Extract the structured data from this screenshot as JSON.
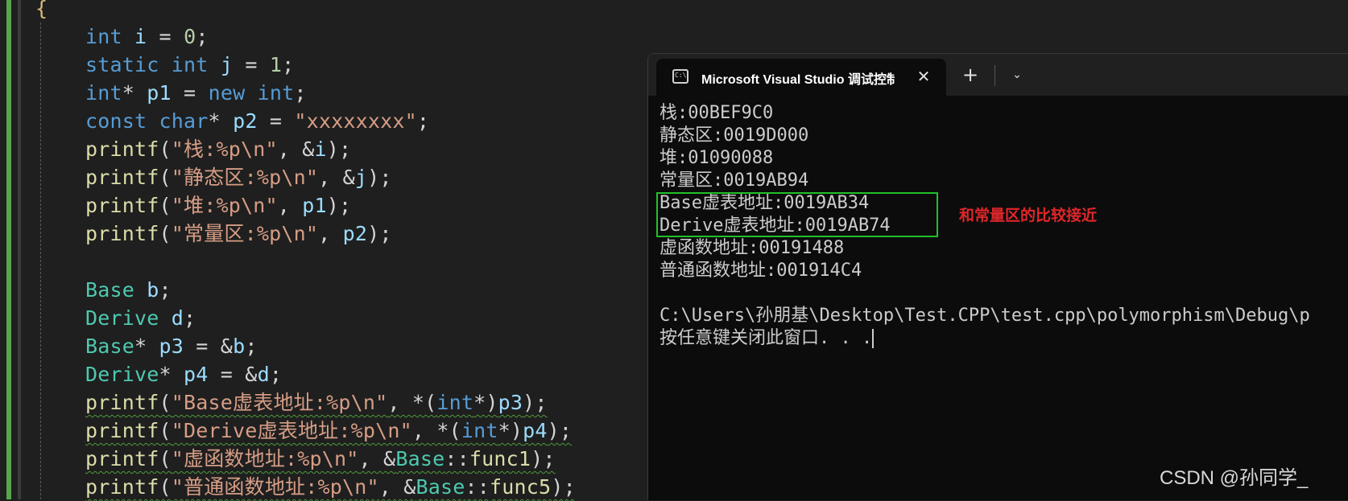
{
  "editor": {
    "open_brace": "{",
    "lines": [
      [
        [
          "kw",
          "int"
        ],
        [
          "op",
          " "
        ],
        [
          "var",
          "i"
        ],
        [
          "op",
          " = "
        ],
        [
          "num",
          "0"
        ],
        [
          "op",
          ";"
        ]
      ],
      [
        [
          "kw",
          "static"
        ],
        [
          "op",
          " "
        ],
        [
          "kw",
          "int"
        ],
        [
          "op",
          " "
        ],
        [
          "var",
          "j"
        ],
        [
          "op",
          " = "
        ],
        [
          "num",
          "1"
        ],
        [
          "op",
          ";"
        ]
      ],
      [
        [
          "kw",
          "int"
        ],
        [
          "op",
          "* "
        ],
        [
          "var",
          "p1"
        ],
        [
          "op",
          " = "
        ],
        [
          "kw",
          "new"
        ],
        [
          "op",
          " "
        ],
        [
          "kw",
          "int"
        ],
        [
          "op",
          ";"
        ]
      ],
      [
        [
          "kw",
          "const"
        ],
        [
          "op",
          " "
        ],
        [
          "kw",
          "char"
        ],
        [
          "op",
          "* "
        ],
        [
          "var",
          "p2"
        ],
        [
          "op",
          " = "
        ],
        [
          "str",
          "\"xxxxxxxx\""
        ],
        [
          "op",
          ";"
        ]
      ],
      [
        [
          "fn",
          "printf"
        ],
        [
          "op",
          "("
        ],
        [
          "str",
          "\"栈:%p\\n\""
        ],
        [
          "op",
          ", &"
        ],
        [
          "var",
          "i"
        ],
        [
          "op",
          ");"
        ]
      ],
      [
        [
          "fn",
          "printf"
        ],
        [
          "op",
          "("
        ],
        [
          "str",
          "\"静态区:%p\\n\""
        ],
        [
          "op",
          ", &"
        ],
        [
          "var",
          "j"
        ],
        [
          "op",
          ");"
        ]
      ],
      [
        [
          "fn",
          "printf"
        ],
        [
          "op",
          "("
        ],
        [
          "str",
          "\"堆:%p\\n\""
        ],
        [
          "op",
          ", "
        ],
        [
          "var",
          "p1"
        ],
        [
          "op",
          ");"
        ]
      ],
      [
        [
          "fn",
          "printf"
        ],
        [
          "op",
          "("
        ],
        [
          "str",
          "\"常量区:%p\\n\""
        ],
        [
          "op",
          ", "
        ],
        [
          "var",
          "p2"
        ],
        [
          "op",
          ");"
        ]
      ],
      [],
      [
        [
          "type",
          "Base"
        ],
        [
          "op",
          " "
        ],
        [
          "var",
          "b"
        ],
        [
          "op",
          ";"
        ]
      ],
      [
        [
          "type",
          "Derive"
        ],
        [
          "op",
          " "
        ],
        [
          "var",
          "d"
        ],
        [
          "op",
          ";"
        ]
      ],
      [
        [
          "type",
          "Base"
        ],
        [
          "op",
          "* "
        ],
        [
          "var",
          "p3"
        ],
        [
          "op",
          " = &"
        ],
        [
          "var",
          "b"
        ],
        [
          "op",
          ";"
        ]
      ],
      [
        [
          "type",
          "Derive"
        ],
        [
          "op",
          "* "
        ],
        [
          "var",
          "p4"
        ],
        [
          "op",
          " = &"
        ],
        [
          "var",
          "d"
        ],
        [
          "op",
          ";"
        ]
      ],
      [
        [
          "fn",
          "printf"
        ],
        [
          "op",
          "("
        ],
        [
          "str",
          "\"Base虚表地址:%p\\n\""
        ],
        [
          "op",
          ", *("
        ],
        [
          "kw",
          "int"
        ],
        [
          "op",
          "*)"
        ],
        [
          "var",
          "p3"
        ],
        [
          "op",
          ");"
        ]
      ],
      [
        [
          "fn",
          "printf"
        ],
        [
          "op",
          "("
        ],
        [
          "str",
          "\"Derive虚表地址:%p\\n\""
        ],
        [
          "op",
          ", *("
        ],
        [
          "kw",
          "int"
        ],
        [
          "op",
          "*)"
        ],
        [
          "var",
          "p4"
        ],
        [
          "op",
          ");"
        ]
      ],
      [
        [
          "fn",
          "printf"
        ],
        [
          "op",
          "("
        ],
        [
          "str",
          "\"虚函数地址:%p\\n\""
        ],
        [
          "op",
          ", &"
        ],
        [
          "type",
          "Base"
        ],
        [
          "op",
          "::"
        ],
        [
          "fn",
          "func1"
        ],
        [
          "op",
          ");"
        ]
      ],
      [
        [
          "fn",
          "printf"
        ],
        [
          "op",
          "("
        ],
        [
          "str",
          "\"普通函数地址:%p\\n\""
        ],
        [
          "op",
          ", &"
        ],
        [
          "type",
          "Base"
        ],
        [
          "op",
          "::"
        ],
        [
          "fn",
          "func5"
        ],
        [
          "op",
          ");"
        ]
      ]
    ],
    "squiggle_lines": [
      13,
      14,
      15,
      16
    ]
  },
  "console": {
    "tab_title": "Microsoft Visual Studio 调试控制台",
    "tab_icon_text": "C:\\",
    "close_symbol": "✕",
    "new_tab_symbol": "+",
    "dropdown_symbol": "⌄",
    "output": [
      "栈:00BEF9C0",
      "静态区:0019D000",
      "堆:01090088",
      "常量区:0019AB94",
      "Base虚表地址:0019AB34",
      "Derive虚表地址:0019AB74",
      "虚函数地址:00191488",
      "普通函数地址:001914C4",
      "",
      "C:\\Users\\孙朋基\\Desktop\\Test.CPP\\test.cpp\\polymorphism\\Debug\\p",
      "按任意键关闭此窗口. . ."
    ],
    "annotation": "和常量区的比较接近"
  },
  "watermark": "CSDN @孙同学_"
}
